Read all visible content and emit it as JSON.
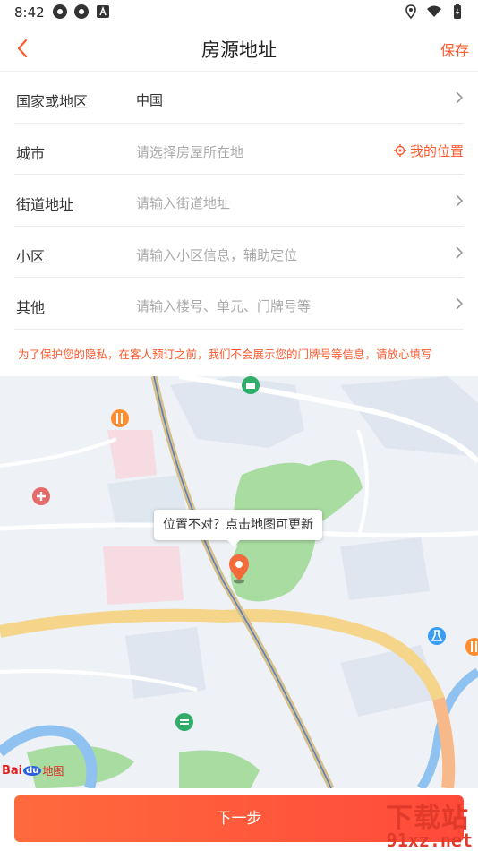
{
  "status_bar": {
    "time": "8:42"
  },
  "nav": {
    "title": "房源地址",
    "save_label": "保存"
  },
  "form": {
    "rows": [
      {
        "label": "国家或地区",
        "value": "中国"
      },
      {
        "label": "城市",
        "placeholder": "请选择房屋所在地",
        "action": "我的位置"
      },
      {
        "label": "街道地址",
        "placeholder": "请输入街道地址"
      },
      {
        "label": "小区",
        "placeholder": "请输入小区信息，辅助定位"
      },
      {
        "label": "其他",
        "placeholder": "请输入楼号、单元、门牌号等"
      }
    ],
    "privacy_note": "为了保护您的隐私，在客人预订之前，我们不会展示您的门牌号等信息，请放心填写"
  },
  "map": {
    "tooltip": "位置不对？点击地图可更新",
    "logo": {
      "bai": "Bai",
      "du": "du",
      "ditu": "地图"
    }
  },
  "bottom": {
    "next_label": "下一步"
  },
  "watermark": {
    "text": "下载站",
    "url": "91xz.net"
  },
  "colors": {
    "accent": "#ff5a2e",
    "button": "#ff5240",
    "map_bg": "#eef1f5",
    "road_major": "#f5d58a",
    "park": "#a8dca0"
  },
  "icons": [
    "back-chevron-icon",
    "chevron-right-icon",
    "location-target-icon",
    "map-pin-icon",
    "poi-restaurant-icon",
    "poi-hospital-icon",
    "poi-shop-icon",
    "poi-lab-icon",
    "poi-post-icon"
  ]
}
